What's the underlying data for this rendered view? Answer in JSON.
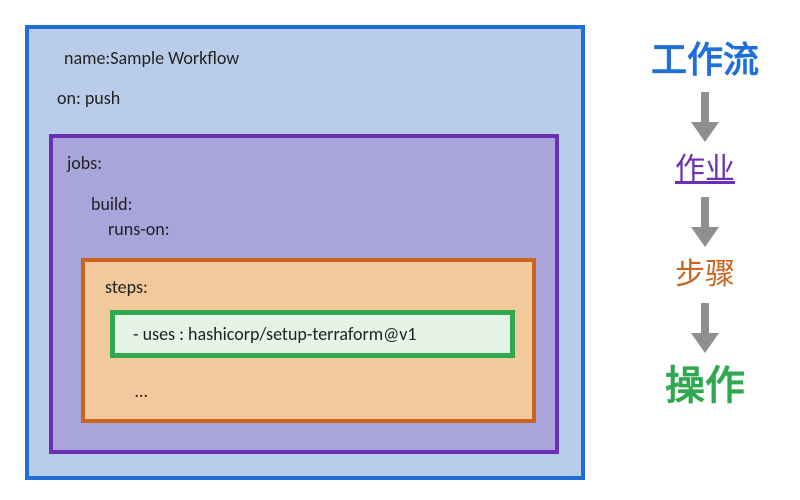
{
  "workflow": {
    "name_line": "name:Sample Workflow",
    "on_line": "on: push",
    "jobs_label": "jobs:",
    "build_label": "build:",
    "runs_on_label": "runs-on:",
    "steps_label": "steps:",
    "uses_line": "- uses : hashicorp/setup-terraform@v1",
    "more_label": "…"
  },
  "legend": {
    "workflow": "工作流",
    "job": "作业",
    "step": "步骤",
    "action": "操作"
  },
  "colors": {
    "blue": "#1e6fd9",
    "purple": "#6b2fb3",
    "orange": "#c9651f",
    "green": "#2fa84f"
  }
}
